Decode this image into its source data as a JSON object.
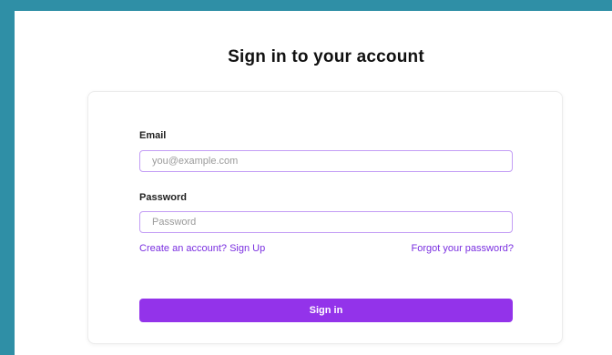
{
  "title": "Sign in to your account",
  "form": {
    "email_label": "Email",
    "email_placeholder": "you@example.com",
    "email_value": "",
    "password_label": "Password",
    "password_placeholder": "Password",
    "password_value": "",
    "signup_link": "Create an account? Sign Up",
    "forgot_link": "Forgot your password?",
    "submit_label": "Sign in"
  },
  "colors": {
    "background": "#2f8fa6",
    "accent": "#9333ea",
    "link": "#7a2fe0",
    "input_border": "#c39df5"
  }
}
